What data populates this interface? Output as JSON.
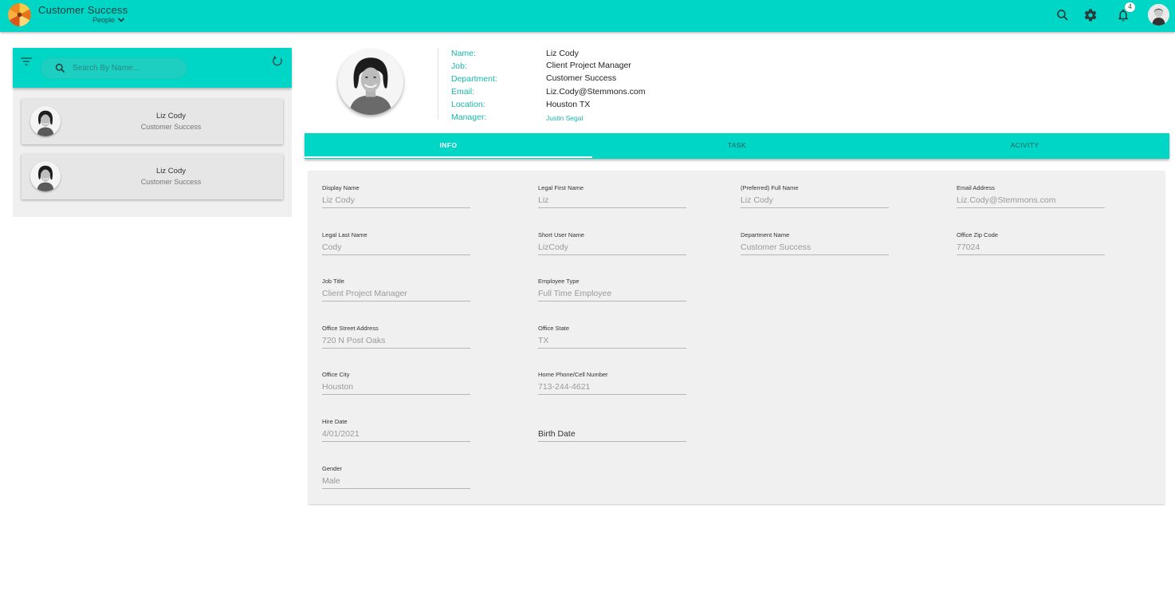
{
  "appbar": {
    "title": "Customer Success",
    "subtitle": "People",
    "notification_count": "4",
    "colors": {
      "accent": "#00d6c6",
      "accent_text": "#19b5a9"
    },
    "icons": [
      "app-logo-icon",
      "search-icon",
      "gear-icon",
      "bell-icon",
      "user-avatar"
    ]
  },
  "sidebar": {
    "search_placeholder": "Search By Name...",
    "people": [
      {
        "name": "Liz Cody",
        "department": "Customer Success"
      },
      {
        "name": "Liz Cody",
        "department": "Customer Success"
      }
    ]
  },
  "profile": {
    "labels": {
      "name": "Name:",
      "job": "Job:",
      "department": "Department:",
      "email": "Email:",
      "location": "Location:",
      "manager": "Manager:"
    },
    "values": {
      "name": "Liz Cody",
      "job": "Client Project Manager",
      "department": "Customer Success",
      "email": "Liz.Cody@Stemmons.com",
      "location": "Houston TX",
      "manager": "Justin Segal"
    }
  },
  "tabs": [
    {
      "label": "INFO",
      "active": true
    },
    {
      "label": "TASK",
      "active": false
    },
    {
      "label": "ACIVITY",
      "active": false
    }
  ],
  "form": {
    "display_name": {
      "label": "Display Name",
      "value": "Liz Cody"
    },
    "legal_first_name": {
      "label": "Legal First Name",
      "value": "Liz"
    },
    "preferred_full_name": {
      "label": "(Preferred) Full Name",
      "value": "Liz Cody"
    },
    "email_address": {
      "label": "Email Address",
      "value": "Liz.Cody@Stemmons.com"
    },
    "legal_last_name": {
      "label": "Legal Last Name",
      "value": "Cody"
    },
    "short_user_name": {
      "label": "Short User Name",
      "value": "LizCody"
    },
    "department_name": {
      "label": "Department Name",
      "value": "Customer Success"
    },
    "office_zip_code": {
      "label": "Office Zip Code",
      "value": "77024"
    },
    "job_title": {
      "label": "Job Title",
      "value": "Client Project Manager"
    },
    "employee_type": {
      "label": "Employee Type",
      "value": "Full Time Employee"
    },
    "office_street_address": {
      "label": "Office Street Address",
      "value": "720 N Post Oaks"
    },
    "office_state": {
      "label": "Office State",
      "value": "TX"
    },
    "office_city": {
      "label": "Office City",
      "value": "Houston"
    },
    "home_phone": {
      "label": "Home Phone/Cell Number",
      "value": "713-244-4621"
    },
    "hire_date": {
      "label": "Hire Date",
      "value": "4/01/2021"
    },
    "birth_date": {
      "placeholder": "Birth Date"
    },
    "gender": {
      "label": "Gender",
      "value": "Male"
    }
  }
}
